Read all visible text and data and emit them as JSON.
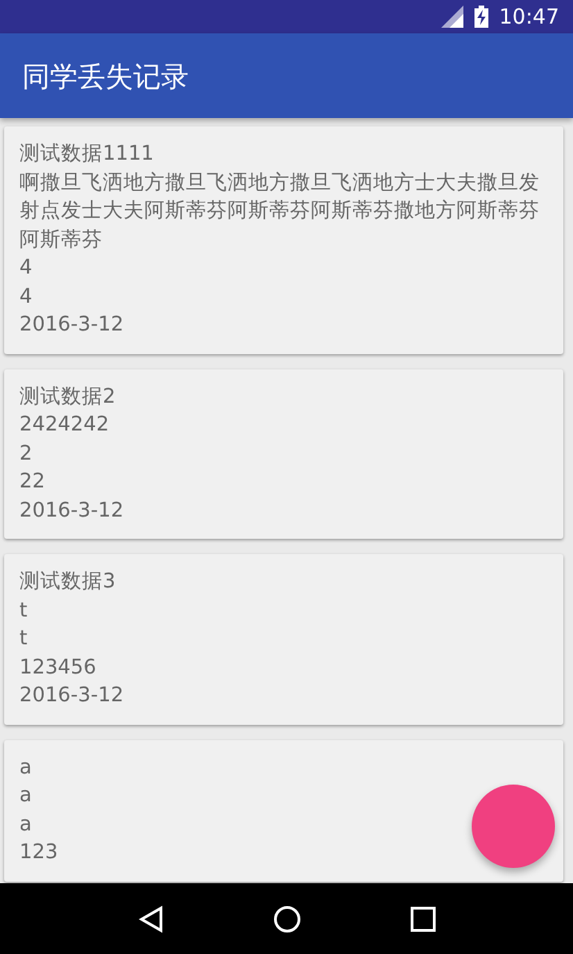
{
  "status_bar": {
    "time": "10:47"
  },
  "app_bar": {
    "title": "同学丢失记录"
  },
  "records": [
    {
      "lines": [
        "测试数据1111",
        "啊撒旦飞洒地方撒旦飞洒地方撒旦飞洒地方士大夫撒旦发射点发士大夫阿斯蒂芬阿斯蒂芬阿斯蒂芬撒地方阿斯蒂芬阿斯蒂芬",
        "4",
        "4",
        "2016-3-12"
      ]
    },
    {
      "lines": [
        "测试数据2",
        "2424242",
        "2",
        "22",
        "2016-3-12"
      ]
    },
    {
      "lines": [
        "测试数据3",
        "t",
        "t",
        "123456",
        "2016-3-12"
      ]
    },
    {
      "lines": [
        "a",
        "a",
        "a",
        "123"
      ]
    }
  ]
}
